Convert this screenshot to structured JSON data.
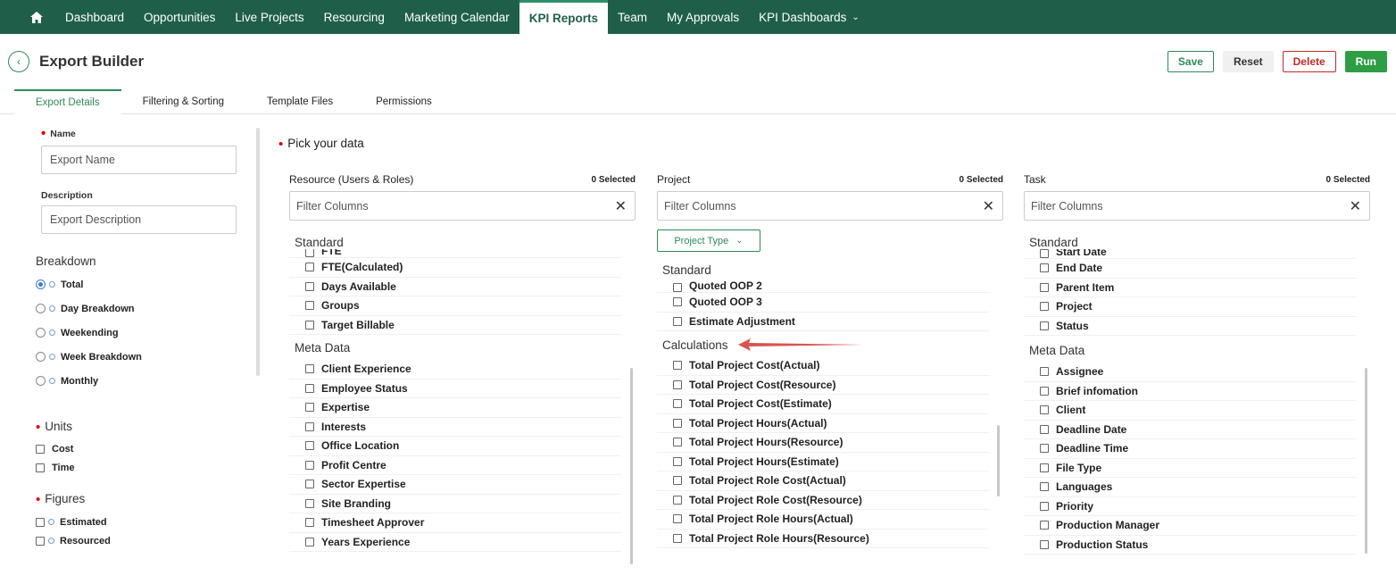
{
  "nav": {
    "items": [
      "Dashboard",
      "Opportunities",
      "Live Projects",
      "Resourcing",
      "Marketing Calendar",
      "KPI Reports",
      "Team",
      "My Approvals",
      "KPI Dashboards"
    ],
    "active": "KPI Reports"
  },
  "header": {
    "title": "Export Builder",
    "save": "Save",
    "reset": "Reset",
    "delete": "Delete",
    "run": "Run"
  },
  "tabs": [
    "Export Details",
    "Filtering & Sorting",
    "Template Files",
    "Permissions"
  ],
  "left": {
    "name_label": "Name",
    "name_placeholder": "Export Name",
    "desc_label": "Description",
    "desc_placeholder": "Export Description",
    "breakdown_title": "Breakdown",
    "breakdown_options": [
      "Total",
      "Day Breakdown",
      "Weekending",
      "Week Breakdown",
      "Monthly"
    ],
    "breakdown_selected": "Total",
    "units_title": "Units",
    "units": [
      "Cost",
      "Time"
    ],
    "figures_title": "Figures",
    "figures": [
      "Estimated",
      "Resourced"
    ]
  },
  "main": {
    "pick_title": "Pick your data",
    "filter_placeholder": "Filter Columns",
    "resource": {
      "title": "Resource (Users & Roles)",
      "count": "0 Selected",
      "standard_title": "Standard",
      "standard": [
        "FTE",
        "FTE(Calculated)",
        "Days Available",
        "Groups",
        "Target Billable"
      ],
      "meta_title": "Meta Data",
      "meta": [
        "Client Experience",
        "Employee Status",
        "Expertise",
        "Interests",
        "Office Location",
        "Profit Centre",
        "Sector Expertise",
        "Site Branding",
        "Timesheet Approver",
        "Years Experience"
      ]
    },
    "project": {
      "title": "Project",
      "count": "0 Selected",
      "project_type": "Project Type",
      "standard_title": "Standard",
      "standard": [
        "Quoted OOP 2",
        "Quoted OOP 3",
        "Estimate Adjustment"
      ],
      "calc_title": "Calculations",
      "calc": [
        "Total Project Cost(Actual)",
        "Total Project Cost(Resource)",
        "Total Project Cost(Estimate)",
        "Total Project Hours(Actual)",
        "Total Project Hours(Resource)",
        "Total Project Hours(Estimate)",
        "Total Project Role Cost(Actual)",
        "Total Project Role Cost(Resource)",
        "Total Project Role Hours(Actual)",
        "Total Project Role Hours(Resource)"
      ]
    },
    "task": {
      "title": "Task",
      "count": "0 Selected",
      "standard_title": "Standard",
      "standard": [
        "Start Date",
        "End Date",
        "Parent Item",
        "Project",
        "Status"
      ],
      "meta_title": "Meta Data",
      "meta": [
        "Assignee",
        "Brief infomation",
        "Client",
        "Deadline Date",
        "Deadline Time",
        "File Type",
        "Languages",
        "Priority",
        "Production Manager",
        "Production Status"
      ]
    }
  },
  "colors": {
    "nav_bg": "#1f5f4a",
    "accent": "#2e8b57",
    "danger": "#c62828",
    "run": "#2e9e44",
    "arrow": "#d9534f"
  }
}
